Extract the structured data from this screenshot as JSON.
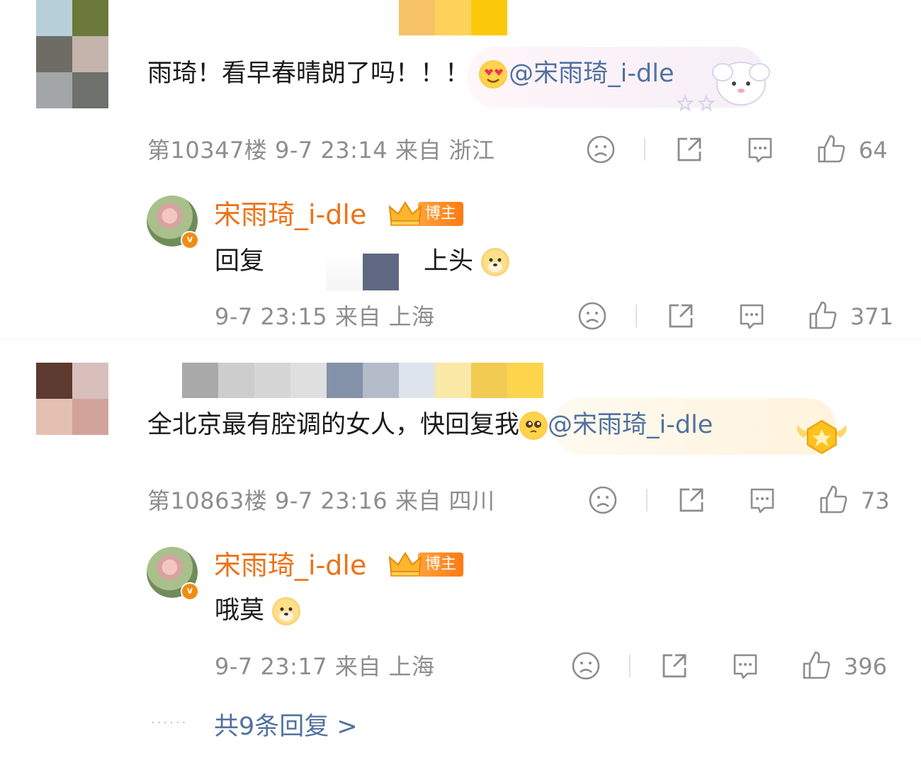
{
  "comments": [
    {
      "text": "雨琦！看早春晴朗了吗！！！",
      "emoji": "heart-eyes-emoji",
      "mention": "@宋雨琦_i-dle",
      "floor": "第10347楼",
      "time": "9-7 23:14",
      "from_label": "来自",
      "location": "浙江",
      "likes": "64",
      "reply": {
        "name": "宋雨琦_i-dle",
        "badge": "博主",
        "text_prefix": "回复",
        "text_suffix": "上头",
        "emoji": "doge-emoji",
        "time": "9-7 23:15",
        "from_label": "来自",
        "location": "上海",
        "likes": "371"
      }
    },
    {
      "text": "全北京最有腔调的女人，快回复我",
      "emoji": "pleading-emoji",
      "mention": "@宋雨琦_i-dle",
      "floor": "第10863楼",
      "time": "9-7 23:16",
      "from_label": "来自",
      "location": "四川",
      "likes": "73",
      "reply": {
        "name": "宋雨琦_i-dle",
        "badge": "博主",
        "text_prefix": "哦莫",
        "emoji": "doge-emoji",
        "time": "9-7 23:17",
        "from_label": "来自",
        "location": "上海",
        "likes": "396"
      }
    }
  ],
  "more_replies": "共9条回复 >",
  "colors": {
    "accent_name": "#eb7318",
    "mention": "#5072a0",
    "meta": "#8d8d8d",
    "badge": "#ff8a1e"
  },
  "icons": [
    "dislike-face-icon",
    "share-icon",
    "comment-icon",
    "like-thumb-icon"
  ]
}
